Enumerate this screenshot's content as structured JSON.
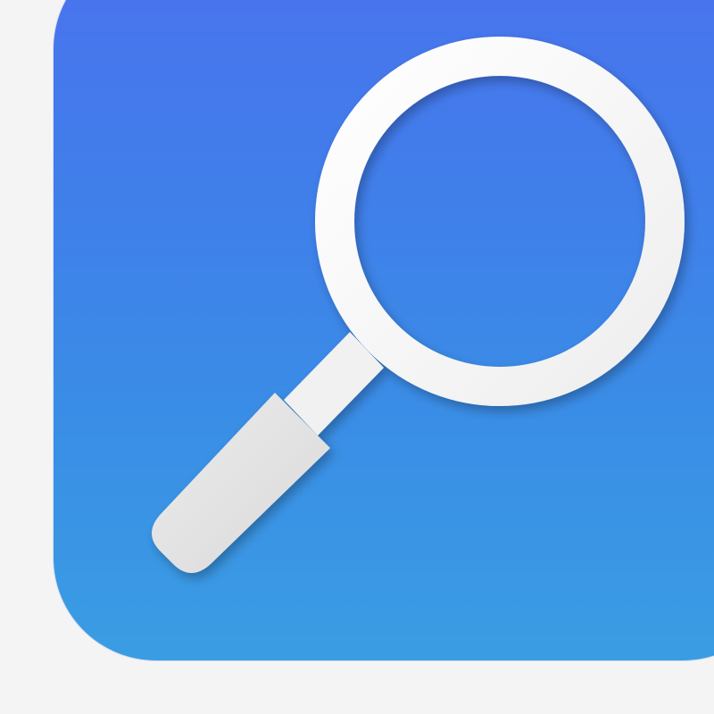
{
  "app_icon": {
    "icon": "magnifying-glass-icon",
    "colors": {
      "gradient_top": "#4a72ee",
      "gradient_bottom": "#3a9de3",
      "glass_ring": "#ffffff",
      "handle": "#e3e3e3",
      "page_background": "#f4f4f4"
    }
  }
}
